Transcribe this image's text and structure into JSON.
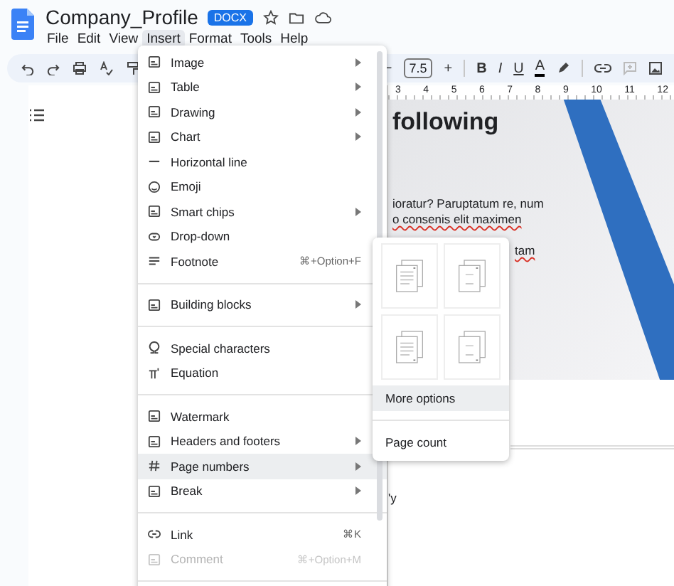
{
  "header": {
    "title": "Company_Profile",
    "badge": "DOCX",
    "menus": [
      {
        "label": "File",
        "selected": false
      },
      {
        "label": "Edit",
        "selected": false
      },
      {
        "label": "View",
        "selected": false
      },
      {
        "label": "Insert",
        "selected": true
      },
      {
        "label": "Format",
        "selected": false
      },
      {
        "label": "Tools",
        "selected": false
      },
      {
        "label": "Help",
        "selected": false
      }
    ]
  },
  "toolbar": {
    "decrease": "−",
    "font_size": "7.5",
    "increase": "+",
    "bold": "B",
    "italic": "I",
    "underline": "U",
    "text_color": "A"
  },
  "ruler": {
    "marks": [
      "3",
      "4",
      "5",
      "6",
      "7",
      "8",
      "9",
      "10",
      "11",
      "12"
    ]
  },
  "document": {
    "heading": "following",
    "lines": [
      "ioratur? Paruptatum re, num",
      "o consenis elit maximen"
    ],
    "misspelled": "tam",
    "tail": "'y"
  },
  "insert_menu": {
    "items": [
      {
        "kind": "item",
        "label": "Image",
        "submenu": true,
        "selected": false,
        "disabled": false
      },
      {
        "kind": "item",
        "label": "Table",
        "submenu": true,
        "selected": false,
        "disabled": false
      },
      {
        "kind": "item",
        "label": "Drawing",
        "submenu": true,
        "selected": false,
        "disabled": false
      },
      {
        "kind": "item",
        "label": "Chart",
        "submenu": true,
        "selected": false,
        "disabled": false
      },
      {
        "kind": "item",
        "label": "Horizontal line",
        "submenu": false,
        "selected": false,
        "disabled": false
      },
      {
        "kind": "item",
        "label": "Emoji",
        "submenu": false,
        "selected": false,
        "disabled": false
      },
      {
        "kind": "item",
        "label": "Smart chips",
        "submenu": true,
        "selected": false,
        "disabled": false
      },
      {
        "kind": "item",
        "label": "Drop-down",
        "submenu": false,
        "selected": false,
        "disabled": false
      },
      {
        "kind": "item",
        "label": "Footnote",
        "shortcut": "⌘+Option+F",
        "submenu": false,
        "selected": false,
        "disabled": false
      },
      {
        "kind": "divider"
      },
      {
        "kind": "item",
        "label": "Building blocks",
        "submenu": true,
        "selected": false,
        "disabled": false
      },
      {
        "kind": "divider"
      },
      {
        "kind": "item",
        "label": "Special characters",
        "submenu": false,
        "selected": false,
        "disabled": false
      },
      {
        "kind": "item",
        "label": "Equation",
        "submenu": false,
        "selected": false,
        "disabled": false
      },
      {
        "kind": "divider"
      },
      {
        "kind": "item",
        "label": "Watermark",
        "submenu": false,
        "selected": false,
        "disabled": false
      },
      {
        "kind": "item",
        "label": "Headers and footers",
        "submenu": true,
        "selected": false,
        "disabled": false
      },
      {
        "kind": "item",
        "label": "Page numbers",
        "submenu": true,
        "selected": true,
        "disabled": false
      },
      {
        "kind": "item",
        "label": "Break",
        "submenu": true,
        "selected": false,
        "disabled": false
      },
      {
        "kind": "divider"
      },
      {
        "kind": "item",
        "label": "Link",
        "shortcut": "⌘K",
        "submenu": false,
        "selected": false,
        "disabled": false
      },
      {
        "kind": "item",
        "label": "Comment",
        "shortcut": "⌘+Option+M",
        "submenu": false,
        "selected": false,
        "disabled": true
      },
      {
        "kind": "divider"
      }
    ]
  },
  "page_numbers_menu": {
    "options": [
      {
        "label": "More options",
        "selected": true
      },
      {
        "label": "Page count",
        "selected": false
      }
    ]
  }
}
